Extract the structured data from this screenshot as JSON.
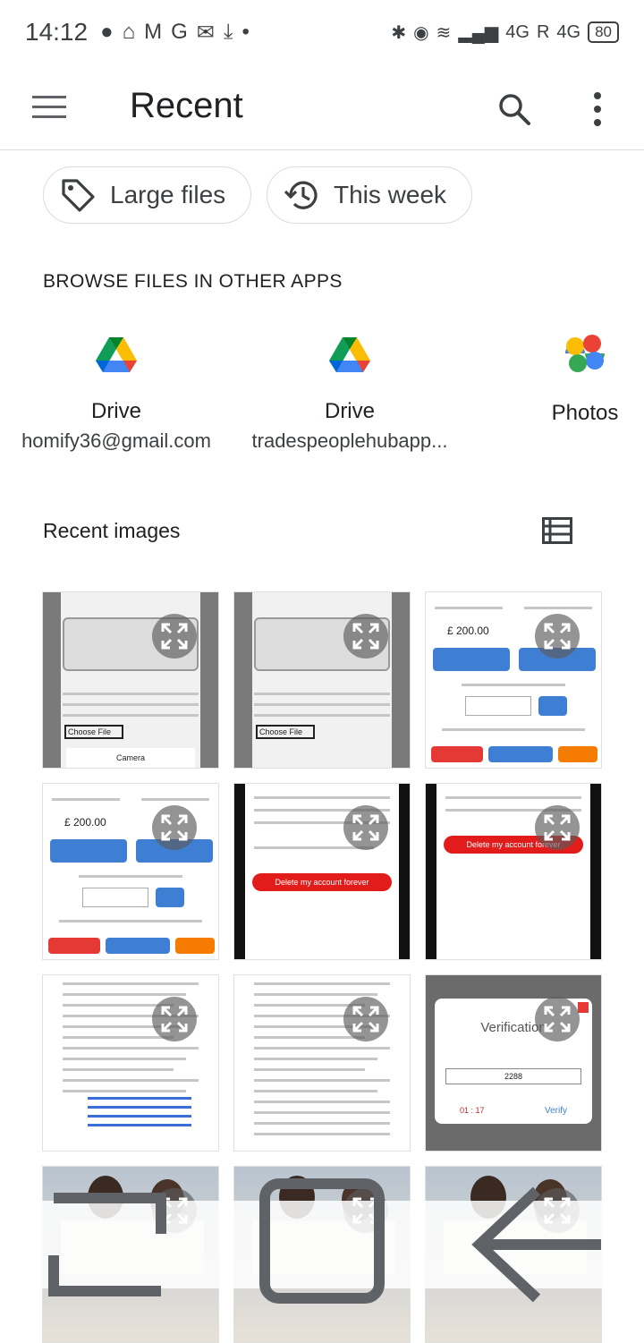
{
  "status": {
    "time": "14:12",
    "battery": "80",
    "net1": "4G",
    "net2": "4G",
    "roaming": "R"
  },
  "appbar": {
    "title": "Recent"
  },
  "chips": [
    {
      "label": "Large files",
      "icon": "tag-icon"
    },
    {
      "label": "This week",
      "icon": "history-icon"
    }
  ],
  "browse": {
    "heading": "BROWSE FILES IN OTHER APPS",
    "apps": [
      {
        "name": "Drive",
        "account": "homify36@gmail.com",
        "icon": "google-drive-icon"
      },
      {
        "name": "Drive",
        "account": "tradespeoplehubapp...",
        "icon": "google-drive-icon"
      },
      {
        "name": "Photos",
        "account": "",
        "icon": "google-photos-icon"
      }
    ]
  },
  "recent": {
    "heading": "Recent images"
  },
  "thumbs": [
    {
      "theme": "form-grey"
    },
    {
      "theme": "form-grey"
    },
    {
      "theme": "quote"
    },
    {
      "theme": "quote"
    },
    {
      "theme": "delete-dark"
    },
    {
      "theme": "delete-dark2"
    },
    {
      "theme": "text"
    },
    {
      "theme": "text"
    },
    {
      "theme": "verify"
    },
    {
      "theme": "photo"
    },
    {
      "theme": "photo"
    },
    {
      "theme": "photo"
    }
  ],
  "thumb_text": {
    "amount": "£ 200.00",
    "delete": "Delete my account forever",
    "verification": "Verification",
    "verify": "Verify",
    "code": "2288",
    "timer": "01 : 17",
    "camera": "Camera",
    "choose": "Choose File"
  },
  "colors": {
    "primary": "#202124",
    "secondary": "#3c4043",
    "divider": "#dadce0",
    "red": "#e53935",
    "blue": "#3f7fd3"
  }
}
